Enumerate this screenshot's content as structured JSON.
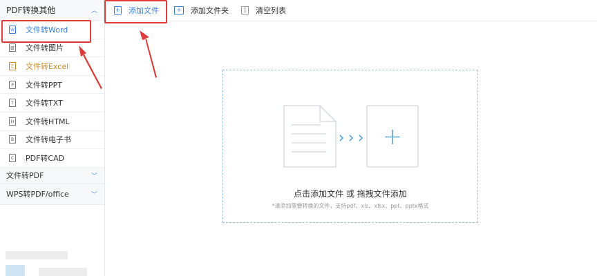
{
  "sidebar": {
    "group1_label": "PDF转换其他",
    "items": [
      {
        "label": "文件转Word",
        "icon": "W"
      },
      {
        "label": "文件转图片",
        "icon": "▨"
      },
      {
        "label": "文件转Excel",
        "icon": "E"
      },
      {
        "label": "文件转PPT",
        "icon": "P"
      },
      {
        "label": "文件转TXT",
        "icon": "T"
      },
      {
        "label": "文件转HTML",
        "icon": "H"
      },
      {
        "label": "文件转电子书",
        "icon": "B"
      },
      {
        "label": "PDF转CAD",
        "icon": "C"
      }
    ],
    "group2_label": "文件转PDF",
    "group3_label": "WPS转PDF/office"
  },
  "toolbar": {
    "add_file": "添加文件",
    "add_folder": "添加文件夹",
    "clear_list": "清空列表"
  },
  "dropzone": {
    "title": "点击添加文件 或 拖拽文件添加",
    "hint": "*请添加需要转换的文件，支持pdf、xls、xlsx、ppt、pptx格式"
  },
  "colors": {
    "accent": "#3a7fdc",
    "highlight": "#e03b3b",
    "excel_item": "#c8902d"
  }
}
